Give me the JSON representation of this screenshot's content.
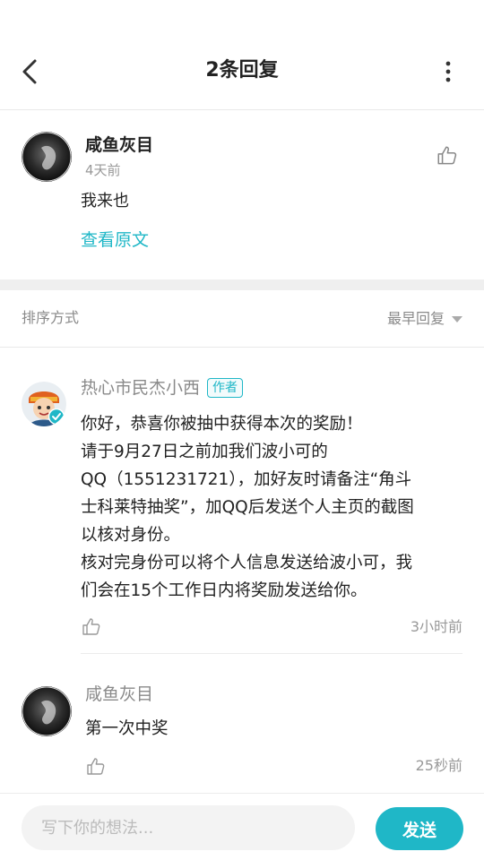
{
  "header": {
    "title": "2条回复",
    "back_icon": "chevron-left-icon",
    "more_icon": "more-vertical-icon"
  },
  "main_comment": {
    "username": "咸鱼灰目",
    "time": "4天前",
    "text": "我来也",
    "view_original_label": "查看原文",
    "like_icon": "thumbs-up-icon"
  },
  "sort": {
    "label": "排序方式",
    "selected": "最早回复"
  },
  "replies": [
    {
      "username": "热心市民杰小西",
      "badge": "作者",
      "lines": [
        "你好，恭喜你被抽中获得本次的奖励！",
        "请于9月27日之前加我们波小可的",
        "QQ（1551231721），加好友时请备注“角斗",
        "士科莱特抽奖”，加QQ后发送个人主页的截图",
        "以核对身份。",
        "核对完身份可以将个人信息发送给波小可，我",
        "们会在15个工作日内将奖励发送给你。"
      ],
      "time": "3小时前"
    },
    {
      "username": "咸鱼灰目",
      "text": "第一次中奖",
      "time": "25秒前"
    }
  ],
  "composer": {
    "placeholder": "写下你的想法...",
    "send_label": "发送"
  },
  "colors": {
    "accent": "#1fb7c7",
    "muted_text": "#8a8a8a",
    "divider": "#efefef"
  }
}
